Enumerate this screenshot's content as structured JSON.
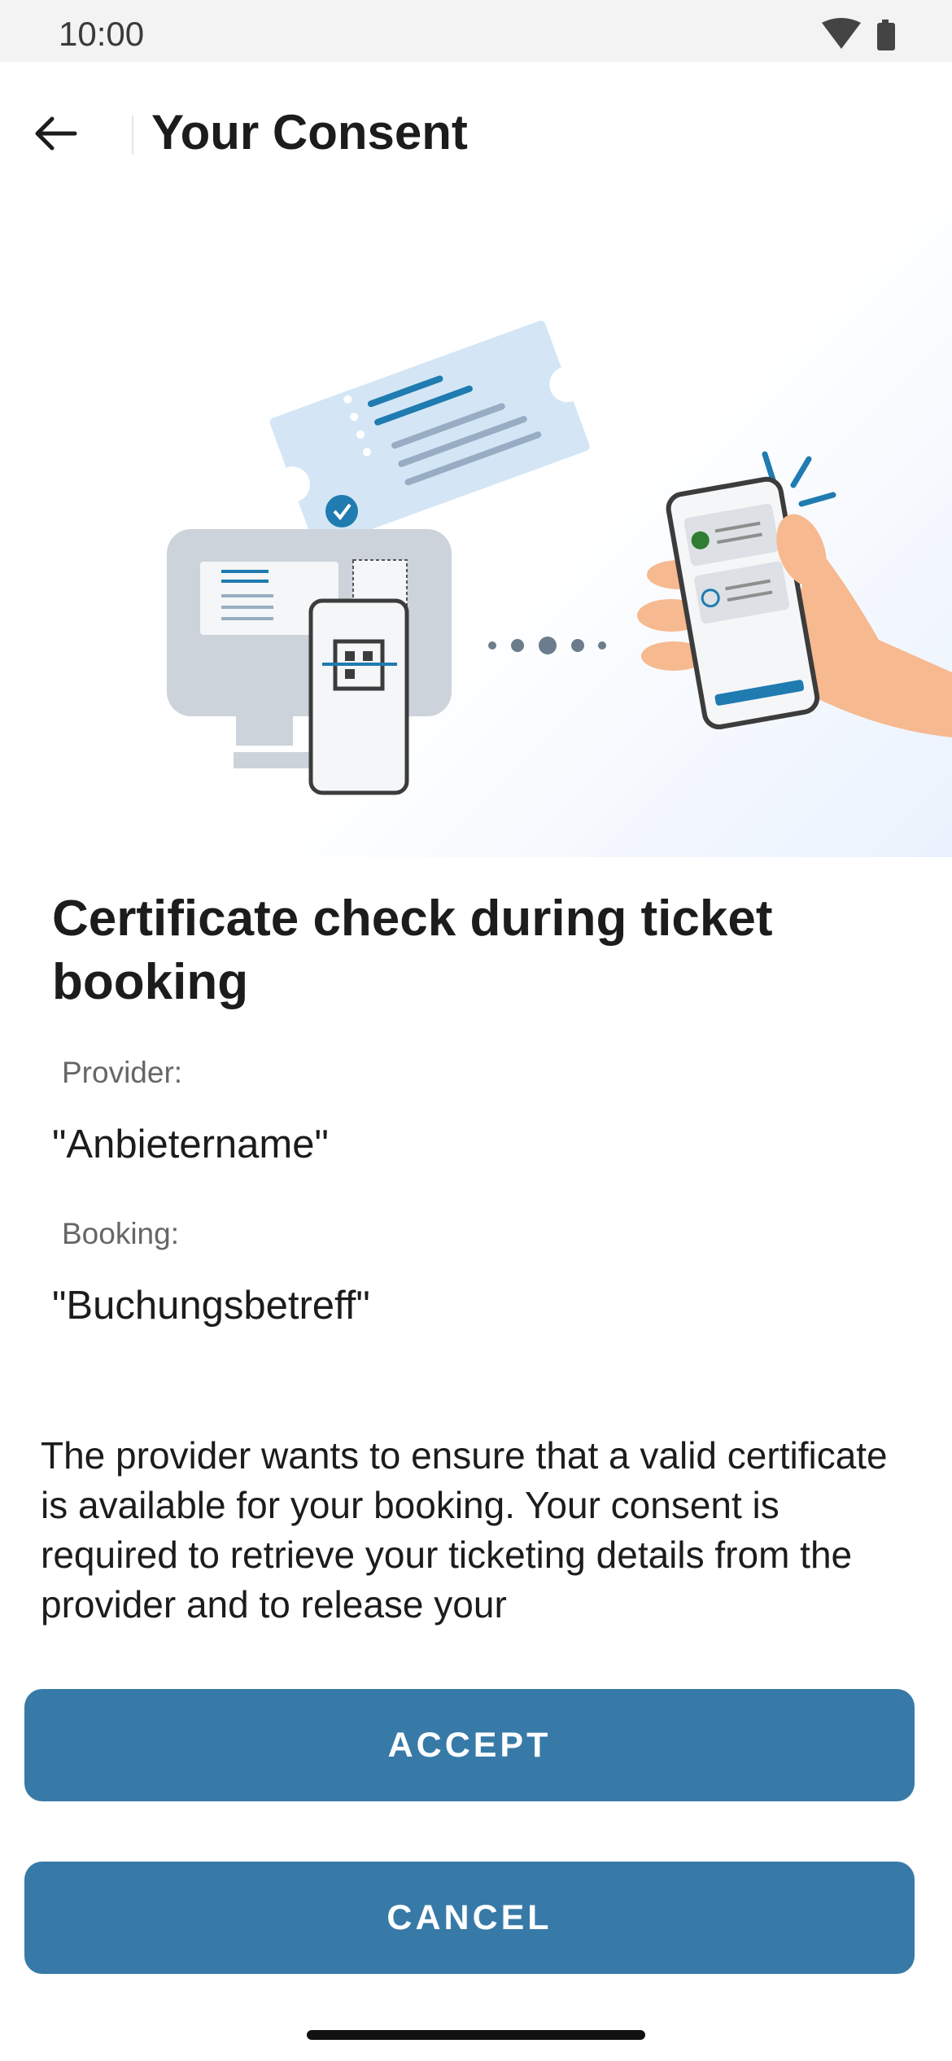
{
  "status_bar": {
    "time": "10:00"
  },
  "header": {
    "title": "Your Consent"
  },
  "content": {
    "headline": "Certificate check during ticket booking",
    "provider_label": "Provider:",
    "provider_value": "\"Anbietername\"",
    "booking_label": "Booking:",
    "booking_value": "\"Buchungsbetreff\"",
    "description": "The provider wants to ensure that a valid certificate is available for your booking. Your consent is required to retrieve your ticketing details from the provider and to release your"
  },
  "actions": {
    "accept_label": "ACCEPT",
    "cancel_label": "CANCEL"
  },
  "colors": {
    "primary": "#377aa8",
    "illustration_blue": "#1f7bb0",
    "skin": "#f7b98f"
  }
}
